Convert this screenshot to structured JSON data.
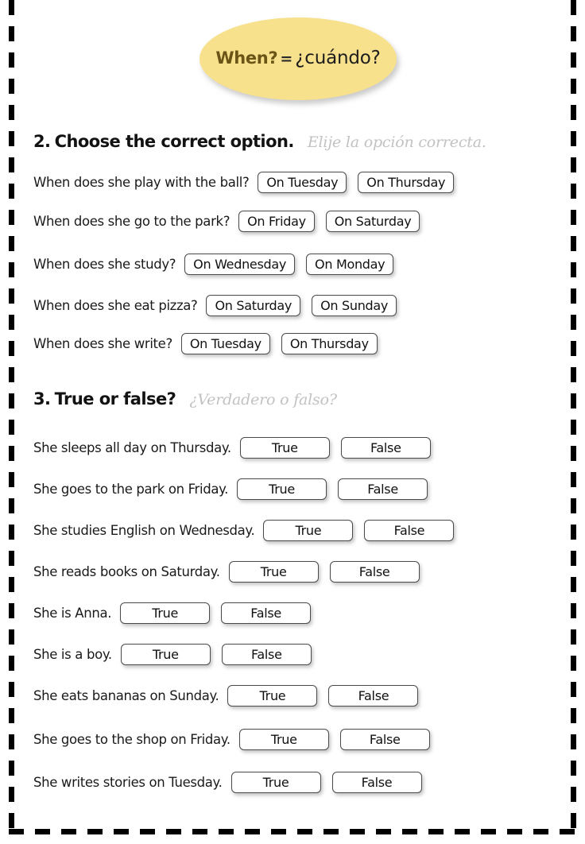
{
  "title": {
    "english": "When?",
    "equals": "=",
    "spanish": "¿cuándo?",
    "bubble_color": "#F7E18C",
    "english_color": "#6B5516"
  },
  "sections": [
    {
      "number": "2.",
      "heading": "Choose the correct option.",
      "subheading": "Elije la opción correcta.",
      "subheading_color": "#C2C2C2",
      "rows": [
        {
          "question": "When does she play with the ball?",
          "options": [
            "On Tuesday",
            "On Thursday"
          ]
        },
        {
          "question": "When does she go to the park?",
          "options": [
            "On Friday",
            "On Saturday"
          ]
        },
        {
          "question": "When does she study?",
          "options": [
            "On Wednesday",
            "On Monday"
          ]
        },
        {
          "question": "When does she eat pizza?",
          "options": [
            "On Saturday",
            "On Sunday"
          ]
        },
        {
          "question": "When does she write?",
          "options": [
            "On Tuesday",
            "On Thursday"
          ]
        }
      ]
    },
    {
      "number": "3.",
      "heading": "True or false?",
      "subheading": "¿Verdadero o falso?",
      "subheading_color": "#C2C2C2",
      "rows": [
        {
          "question": "She sleeps all day on Thursday.",
          "options": [
            "True",
            "False"
          ]
        },
        {
          "question": "She goes to the park on Friday.",
          "options": [
            "True",
            "False"
          ]
        },
        {
          "question": "She studies English on Wednesday.",
          "options": [
            "True",
            "False"
          ]
        },
        {
          "question": "She reads books on Saturday.",
          "options": [
            "True",
            "False"
          ]
        },
        {
          "question": "She is Anna.",
          "options": [
            "True",
            "False"
          ]
        },
        {
          "question": "She is a boy.",
          "options": [
            "True",
            "False"
          ]
        },
        {
          "question": "She eats bananas on Sunday.",
          "options": [
            "True",
            "False"
          ]
        },
        {
          "question": "She goes to the shop on Friday.",
          "options": [
            "True",
            "False"
          ]
        },
        {
          "question": "She writes stories on Tuesday.",
          "options": [
            "True",
            "False"
          ]
        }
      ]
    }
  ]
}
